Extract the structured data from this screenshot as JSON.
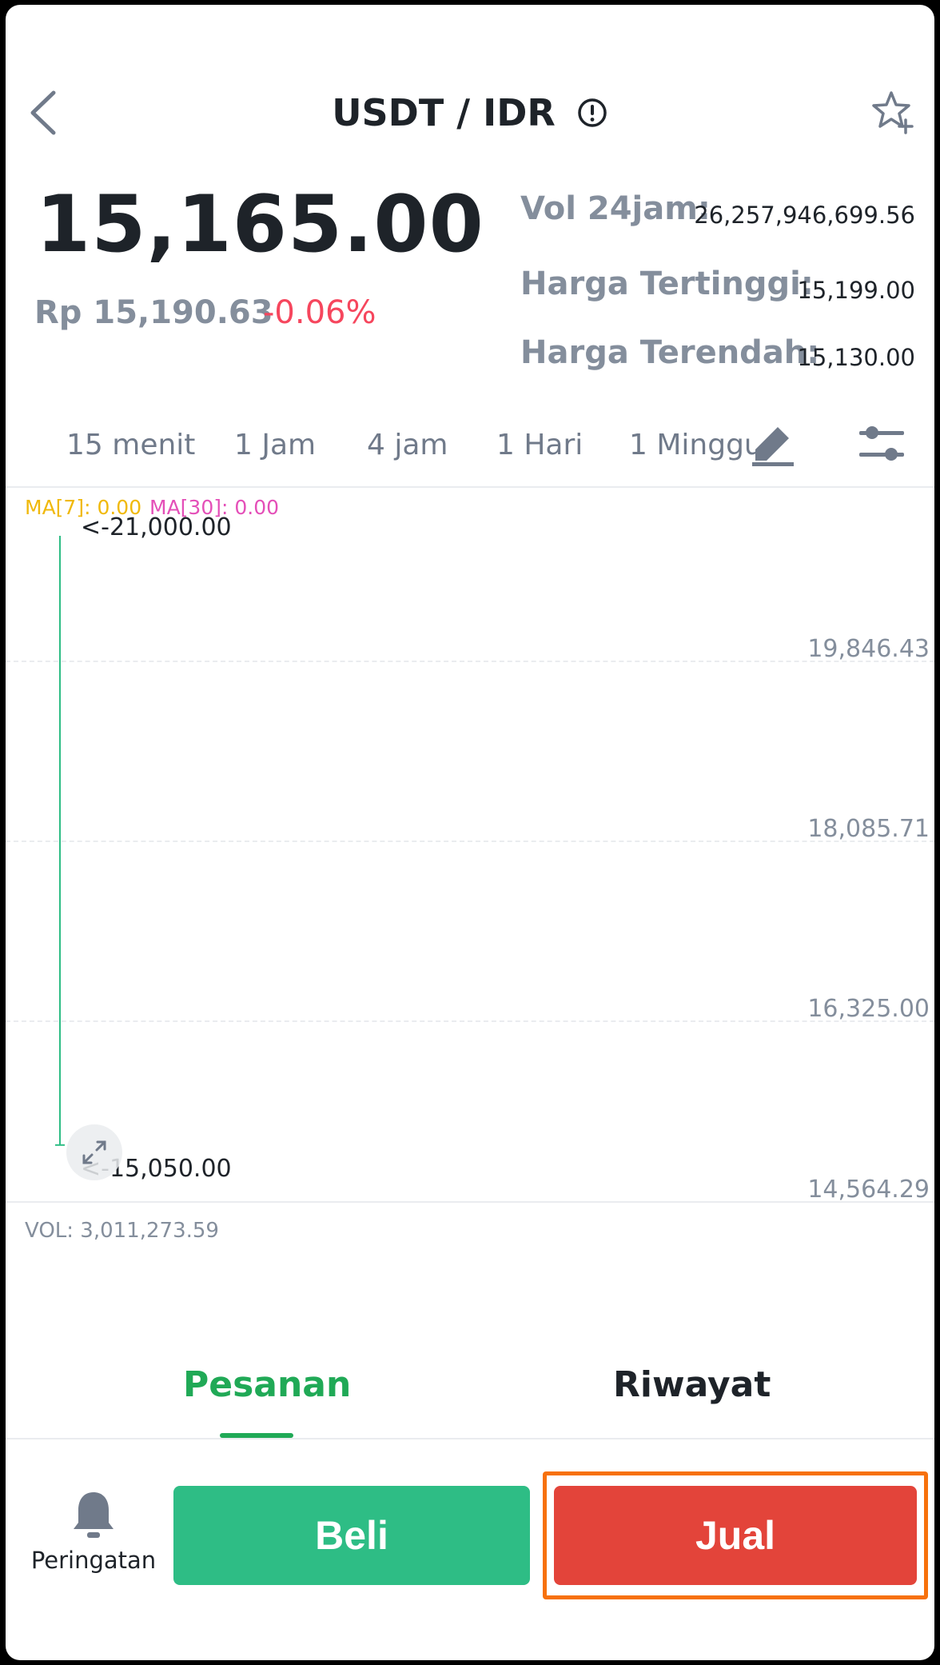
{
  "header": {
    "pair_title": "USDT / IDR",
    "icons": {
      "back": "chevron-left-icon",
      "info": "info-icon",
      "favorite": "star-plus-icon"
    }
  },
  "ticker": {
    "last_price": "15,165.00",
    "fiat_price": "Rp 15,190.63",
    "change_percent": "-0.06%",
    "stats": [
      {
        "label": "Vol 24jam:",
        "value": "26,257,946,699.56"
      },
      {
        "label": "Harga Tertinggi:",
        "value": "15,199.00"
      },
      {
        "label": "Harga Terendah:",
        "value": "15,130.00"
      }
    ]
  },
  "timeframes": [
    "15 menit",
    "1 Jam",
    "4 jam",
    "1 Hari",
    "1 Minggu"
  ],
  "chart": {
    "ma7_label": "MA[7]: 0.00",
    "ma30_label": "MA[30]: 0.00",
    "high_marker": "<-21,000.00",
    "low_marker": "<-15,050.00",
    "vol_label": "VOL: 3,011,273.59"
  },
  "chart_data": {
    "type": "line",
    "y_ticks": [
      "19,846.43",
      "18,085.71",
      "16,325.00",
      "14,564.29"
    ],
    "ylim": [
      14564.29,
      21000.0
    ],
    "high": 21000.0,
    "low": 15050.0,
    "series": [
      {
        "name": "MA[7]",
        "value": 0.0
      },
      {
        "name": "MA[30]",
        "value": 0.0
      }
    ],
    "volume": 3011273.59,
    "colors": {
      "up": "#2ebd85",
      "ma7": "#f0b90b",
      "ma30": "#e44fb8"
    }
  },
  "tabs": {
    "orders": "Pesanan",
    "history": "Riwayat"
  },
  "actions": {
    "alert_label": "Peringatan",
    "buy_label": "Beli",
    "sell_label": "Jual"
  },
  "colors": {
    "buy": "#2ebd85",
    "sell": "#e3443a",
    "active_tab": "#20a956",
    "negative": "#f6465d",
    "highlight": "#f7710c"
  }
}
